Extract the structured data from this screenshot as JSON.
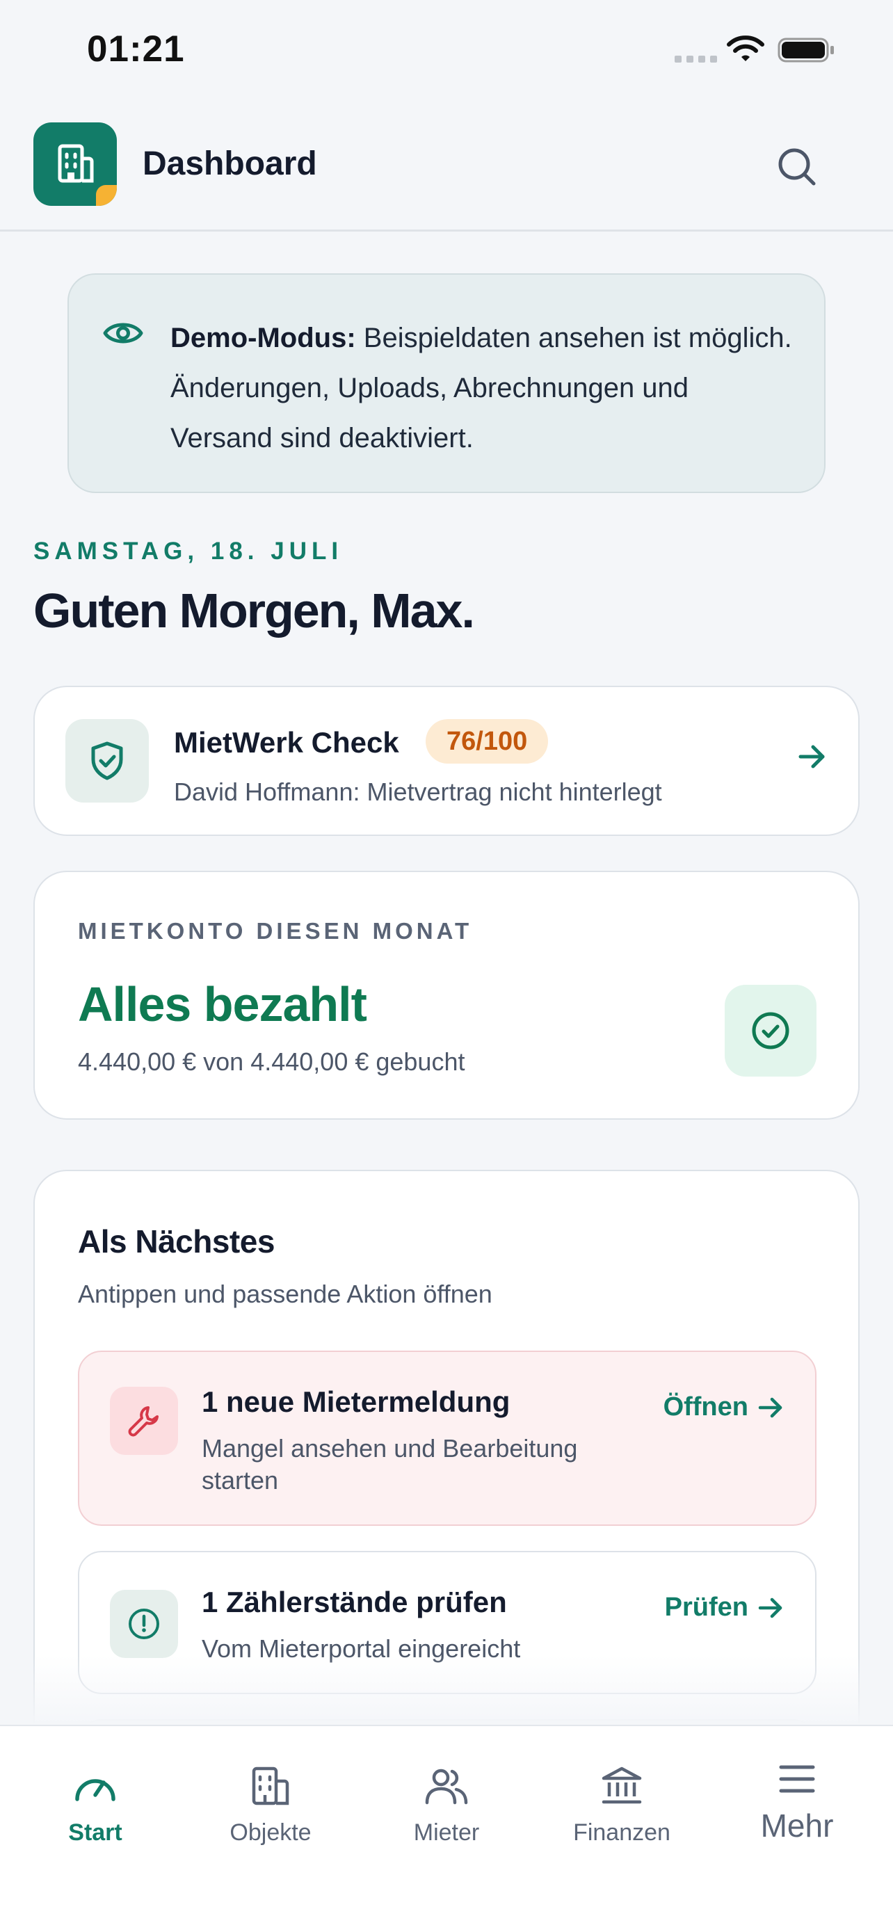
{
  "status_bar": {
    "time": "01:21"
  },
  "header": {
    "title": "Dashboard",
    "logo_icon": "building-icon",
    "search_icon": "search-icon"
  },
  "demo_banner": {
    "icon": "eye-icon",
    "bold": "Demo-Modus:",
    "text": "Beispieldaten ansehen ist möglich. Änderungen, Uploads, Abrechnungen und Versand sind deaktiviert."
  },
  "date_label": "SAMSTAG, 18. JULI",
  "greeting": "Guten Morgen, Max.",
  "check_card": {
    "title": "MietWerk Check",
    "score": "76/100",
    "subtitle": "David Hoffmann: Mietvertrag nicht hinterlegt",
    "icon": "shield-check-icon"
  },
  "rent_card": {
    "label": "MIETKONTO DIESEN MONAT",
    "status": "Alles bezahlt",
    "subtitle": "4.440,00 € von 4.440,00 € gebucht",
    "icon": "check-circle-icon"
  },
  "next_card": {
    "title": "Als Nächstes",
    "subtitle": "Antippen und passende Aktion öffnen",
    "tasks": [
      {
        "title": "1 neue Mietermeldung",
        "desc": "Mangel ansehen und Bearbeitung starten",
        "action": "Öffnen",
        "icon": "wrench-icon"
      },
      {
        "title": "1 Zählerstände prüfen",
        "desc": "Vom Mieterportal eingereicht",
        "action": "Prüfen",
        "icon": "alert-circle-icon"
      }
    ]
  },
  "nav": {
    "items": [
      {
        "label": "Start",
        "icon": "gauge-icon",
        "active": true
      },
      {
        "label": "Objekte",
        "icon": "building-icon"
      },
      {
        "label": "Mieter",
        "icon": "users-icon"
      },
      {
        "label": "Finanzen",
        "icon": "bank-icon"
      },
      {
        "label": "Mehr",
        "icon": "menu-icon"
      }
    ]
  },
  "colors": {
    "brand": "#127c68",
    "accent": "#f6b233",
    "success": "#0f7a52",
    "danger": "#d63848",
    "badge": "#c2570c"
  }
}
